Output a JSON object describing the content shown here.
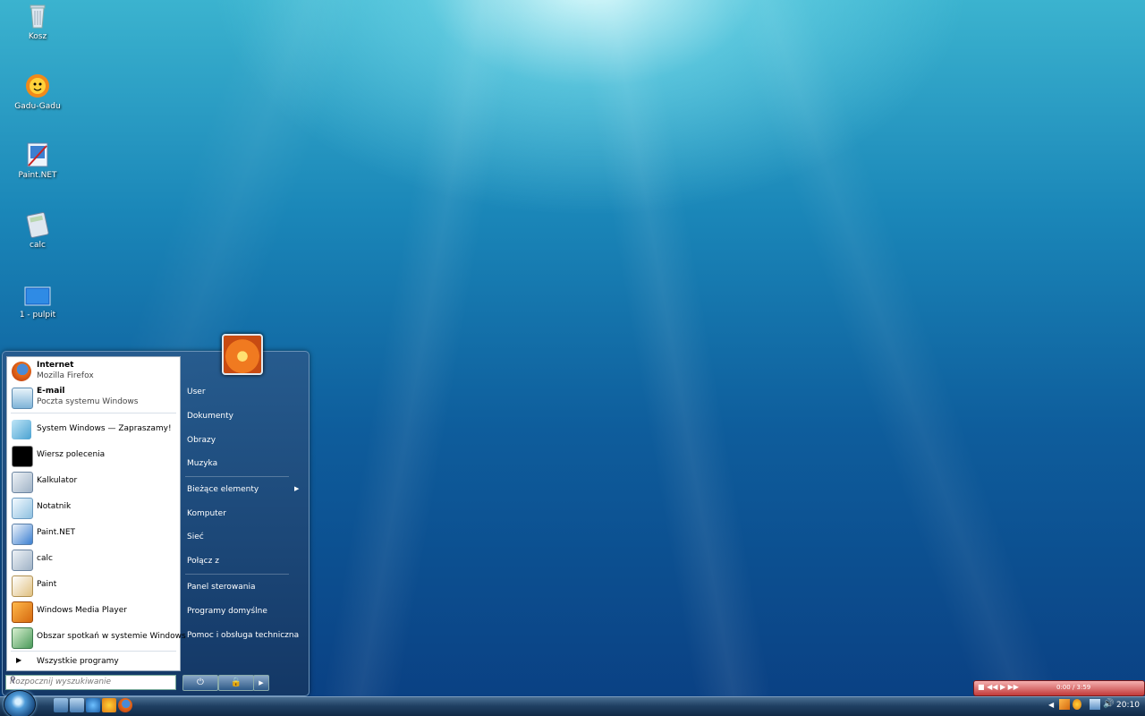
{
  "desktop": {
    "icons": [
      {
        "label": "Kosz",
        "icon": "recycle-bin-icon"
      },
      {
        "label": "Gadu-Gadu",
        "icon": "gadu-gadu-icon"
      },
      {
        "label": "Paint.NET",
        "icon": "paintnet-icon"
      },
      {
        "label": "calc",
        "icon": "calculator-icon"
      },
      {
        "label": "1 - pulpit",
        "icon": "monitor-icon"
      }
    ]
  },
  "start_menu": {
    "pinned": [
      {
        "title": "Internet",
        "subtitle": "Mozilla Firefox",
        "icon": "firefox-icon"
      },
      {
        "title": "E-mail",
        "subtitle": "Poczta systemu Windows",
        "icon": "mail-icon"
      }
    ],
    "recent": [
      {
        "label": "System Windows — Zapraszamy!",
        "icon": "welcome-icon"
      },
      {
        "label": "Wiersz polecenia",
        "icon": "cmd-icon"
      },
      {
        "label": "Kalkulator",
        "icon": "calculator-icon"
      },
      {
        "label": "Notatnik",
        "icon": "notepad-icon"
      },
      {
        "label": "Paint.NET",
        "icon": "paintnet-icon"
      },
      {
        "label": "calc",
        "icon": "calculator-icon"
      },
      {
        "label": "Paint",
        "icon": "paint-icon"
      },
      {
        "label": "Windows Media Player",
        "icon": "media-player-icon"
      },
      {
        "label": "Obszar spotkań w systemie Windows",
        "icon": "meeting-space-icon"
      }
    ],
    "all_programs": "Wszystkie programy",
    "search_placeholder": "Rozpocznij wyszukiwanie",
    "right": [
      "User",
      "Dokumenty",
      "Obrazy",
      "Muzyka",
      "Bieżące elementy",
      "Komputer",
      "Sieć",
      "Połącz z",
      "Panel sterowania",
      "Programy domyślne",
      "Pomoc i obsługa techniczna"
    ]
  },
  "taskbar": {
    "clock": "20:10",
    "media_time": "0:00 / 3:59"
  }
}
